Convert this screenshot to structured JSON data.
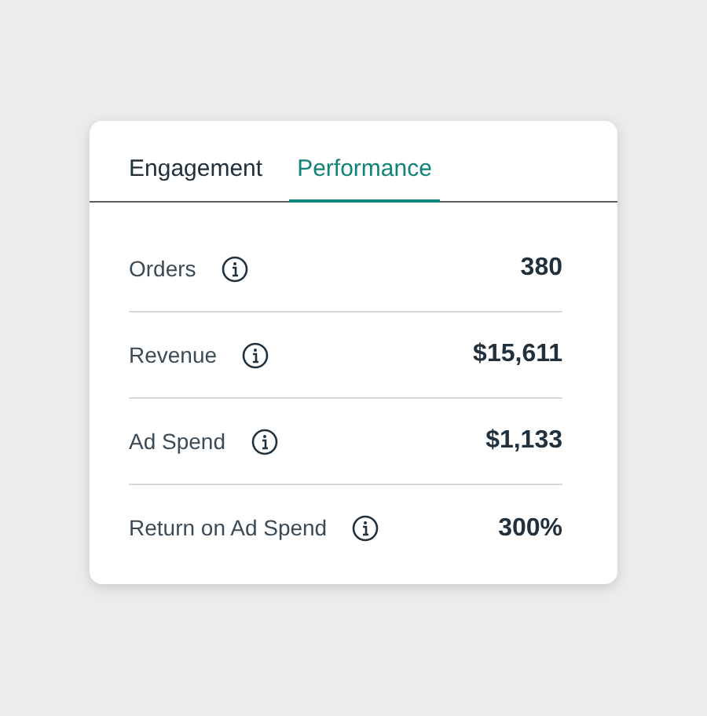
{
  "tabs": [
    {
      "label": "Engagement",
      "selected": false
    },
    {
      "label": "Performance",
      "selected": true
    }
  ],
  "metrics": [
    {
      "label": "Orders",
      "value": "380"
    },
    {
      "label": "Revenue",
      "value": "$15,611"
    },
    {
      "label": "Ad Spend",
      "value": "$1,133"
    },
    {
      "label": "Return on Ad Spend",
      "value": "300%"
    }
  ]
}
